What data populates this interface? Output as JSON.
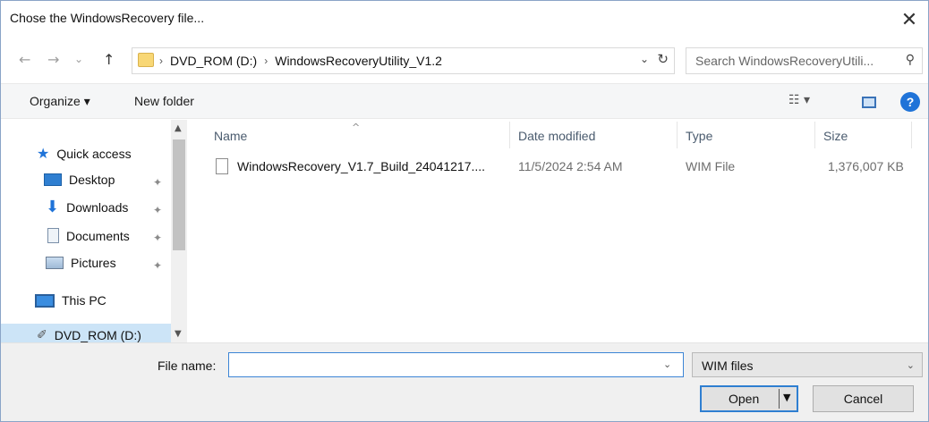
{
  "window": {
    "title": "Chose the WindowsRecovery file..."
  },
  "titlebar": {
    "close_icon": "close-icon",
    "close_glyph": "✕"
  },
  "nav": {
    "back_glyph": "←",
    "forward_glyph": "→",
    "recent_glyph": "⌄",
    "up_glyph": "↑"
  },
  "address": {
    "crumbs": [
      "DVD_ROM (D:)",
      "WindowsRecoveryUtility_V1.2"
    ],
    "sep_glyph": "›",
    "dropdown_glyph": "⌄",
    "refresh_glyph": "↻"
  },
  "search": {
    "placeholder": "Search WindowsRecoveryUtili...",
    "icon_glyph": "⚲"
  },
  "toolbar": {
    "organize_label": "Organize ▾",
    "new_folder_label": "New folder",
    "view_glyph": "☷ ▾",
    "help_glyph": "?"
  },
  "sidebar": {
    "items": [
      {
        "label": "Quick access",
        "icon": "star-icon",
        "pinned": false
      },
      {
        "label": "Desktop",
        "icon": "desktop-icon",
        "pinned": true
      },
      {
        "label": "Downloads",
        "icon": "download-icon",
        "pinned": true
      },
      {
        "label": "Documents",
        "icon": "document-icon",
        "pinned": true
      },
      {
        "label": "Pictures",
        "icon": "pictures-icon",
        "pinned": true
      },
      {
        "label": "This PC",
        "icon": "computer-icon",
        "pinned": false
      },
      {
        "label": "DVD_ROM (D:)",
        "icon": "drive-icon",
        "pinned": false
      }
    ],
    "pin_glyph": "✦",
    "star_glyph": "★",
    "download_glyph": "⬇",
    "drive_glyph": "✐",
    "scroll_up_glyph": "▲",
    "scroll_down_glyph": "▼"
  },
  "file_list": {
    "columns": [
      "Name",
      "Date modified",
      "Type",
      "Size"
    ],
    "sort_glyph": "^",
    "rows": [
      {
        "name": "WindowsRecovery_V1.7_Build_24041217....",
        "date_modified": "11/5/2024 2:54 AM",
        "type": "WIM File",
        "size": "1,376,007 KB"
      }
    ]
  },
  "footer": {
    "file_name_label": "File name:",
    "file_name_value": "",
    "file_name_dropdown_glyph": "⌄",
    "file_type_value": "WIM files",
    "file_type_dropdown_glyph": "⌄",
    "open_label": "Open",
    "open_split_glyph": "▼",
    "cancel_label": "Cancel"
  }
}
